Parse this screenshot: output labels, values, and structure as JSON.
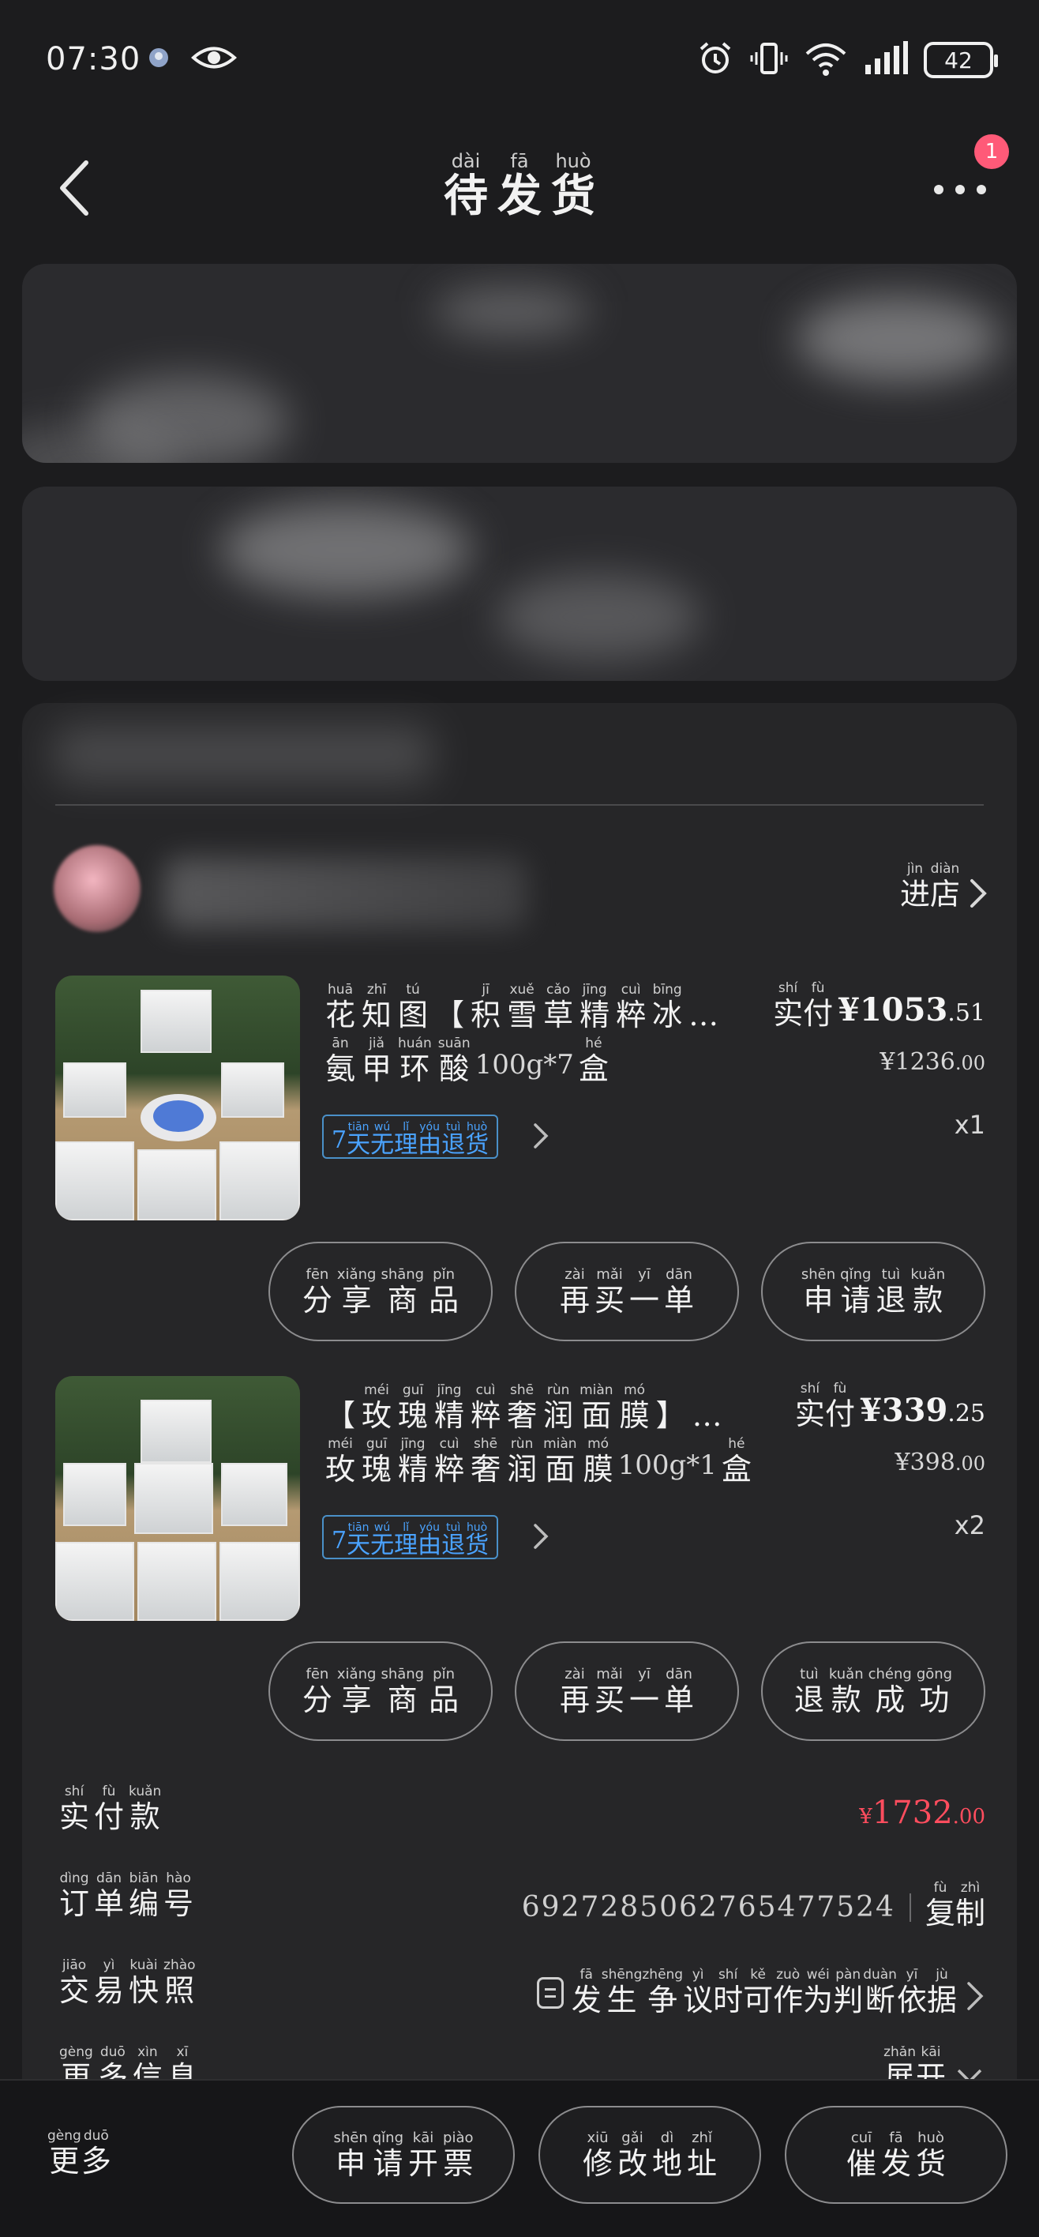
{
  "status_bar": {
    "time": "07:30",
    "battery": "42",
    "icons": [
      "app-notification-icon",
      "eye-icon",
      "alarm-icon",
      "vibrate-icon",
      "wifi-icon",
      "signal-icon",
      "battery-icon"
    ]
  },
  "header": {
    "title": [
      {
        "py": "dài",
        "hz": "待"
      },
      {
        "py": "fā",
        "hz": "发"
      },
      {
        "py": "huò",
        "hz": "货"
      }
    ],
    "badge_count": "1"
  },
  "shop": {
    "enter_store": [
      {
        "py": "jìn",
        "hz": "进"
      },
      {
        "py": "diàn",
        "hz": "店"
      }
    ]
  },
  "products": [
    {
      "title": [
        {
          "py": "huā",
          "hz": "花"
        },
        {
          "py": "zhī",
          "hz": "知"
        },
        {
          "py": "tú",
          "hz": "图"
        },
        {
          "py": "",
          "hz": "【"
        },
        {
          "py": "jī",
          "hz": "积"
        },
        {
          "py": "xuě",
          "hz": "雪"
        },
        {
          "py": "cǎo",
          "hz": "草"
        },
        {
          "py": "jīng",
          "hz": "精"
        },
        {
          "py": "cuì",
          "hz": "粹"
        },
        {
          "py": "bīng",
          "hz": "冰"
        },
        {
          "py": "",
          "hz": "…"
        }
      ],
      "spec_a": [
        {
          "py": "ān",
          "hz": "氨"
        },
        {
          "py": "jiǎ",
          "hz": "甲"
        },
        {
          "py": "huán",
          "hz": "环"
        },
        {
          "py": "suān",
          "hz": "酸"
        }
      ],
      "spec_num": "100g*7",
      "spec_b": [
        {
          "py": "hé",
          "hz": "盒"
        }
      ],
      "paid_label": [
        {
          "py": "shí",
          "hz": "实"
        },
        {
          "py": "fù",
          "hz": "付"
        }
      ],
      "price_int": "¥1053",
      "price_dec": ".51",
      "orig_int": "¥1236",
      "orig_dec": ".00",
      "qty": "x1",
      "buttons": [
        [
          {
            "py": "fēn",
            "hz": "分"
          },
          {
            "py": "xiǎng",
            "hz": "享"
          },
          {
            "py": "shāng",
            "hz": "商"
          },
          {
            "py": "pǐn",
            "hz": "品"
          }
        ],
        [
          {
            "py": "zài",
            "hz": "再"
          },
          {
            "py": "mǎi",
            "hz": "买"
          },
          {
            "py": "yī",
            "hz": "一"
          },
          {
            "py": "dān",
            "hz": "单"
          }
        ],
        [
          {
            "py": "shēn",
            "hz": "申"
          },
          {
            "py": "qǐng",
            "hz": "请"
          },
          {
            "py": "tuì",
            "hz": "退"
          },
          {
            "py": "kuǎn",
            "hz": "款"
          }
        ]
      ]
    },
    {
      "title": [
        {
          "py": "",
          "hz": "【"
        },
        {
          "py": "méi",
          "hz": "玫"
        },
        {
          "py": "guī",
          "hz": "瑰"
        },
        {
          "py": "jīng",
          "hz": "精"
        },
        {
          "py": "cuì",
          "hz": "粹"
        },
        {
          "py": "shē",
          "hz": "奢"
        },
        {
          "py": "rùn",
          "hz": "润"
        },
        {
          "py": "miàn",
          "hz": "面"
        },
        {
          "py": "mó",
          "hz": "膜"
        },
        {
          "py": "",
          "hz": "】"
        },
        {
          "py": "",
          "hz": "…"
        }
      ],
      "spec_a": [
        {
          "py": "méi",
          "hz": "玫"
        },
        {
          "py": "guī",
          "hz": "瑰"
        },
        {
          "py": "jīng",
          "hz": "精"
        },
        {
          "py": "cuì",
          "hz": "粹"
        },
        {
          "py": "shē",
          "hz": "奢"
        },
        {
          "py": "rùn",
          "hz": "润"
        },
        {
          "py": "miàn",
          "hz": "面"
        },
        {
          "py": "mó",
          "hz": "膜"
        }
      ],
      "spec_num": "100g*1",
      "spec_b": [
        {
          "py": "hé",
          "hz": "盒"
        }
      ],
      "paid_label": [
        {
          "py": "shí",
          "hz": "实"
        },
        {
          "py": "fù",
          "hz": "付"
        }
      ],
      "price_int": "¥339",
      "price_dec": ".25",
      "orig_int": "¥398",
      "orig_dec": ".00",
      "qty": "x2",
      "buttons": [
        [
          {
            "py": "fēn",
            "hz": "分"
          },
          {
            "py": "xiǎng",
            "hz": "享"
          },
          {
            "py": "shāng",
            "hz": "商"
          },
          {
            "py": "pǐn",
            "hz": "品"
          }
        ],
        [
          {
            "py": "zài",
            "hz": "再"
          },
          {
            "py": "mǎi",
            "hz": "买"
          },
          {
            "py": "yī",
            "hz": "一"
          },
          {
            "py": "dān",
            "hz": "单"
          }
        ],
        [
          {
            "py": "tuì",
            "hz": "退"
          },
          {
            "py": "kuǎn",
            "hz": "款"
          },
          {
            "py": "chéng",
            "hz": "成"
          },
          {
            "py": "gōng",
            "hz": "功"
          }
        ]
      ]
    }
  ],
  "return_badge": {
    "num": "7",
    "text": [
      {
        "py": "tiān",
        "hz": "天"
      },
      {
        "py": "wú",
        "hz": "无"
      },
      {
        "py": "lǐ",
        "hz": "理"
      },
      {
        "py": "yóu",
        "hz": "由"
      },
      {
        "py": "tuì",
        "hz": "退"
      },
      {
        "py": "huò",
        "hz": "货"
      }
    ]
  },
  "summary": {
    "total_label": [
      {
        "py": "shí",
        "hz": "实"
      },
      {
        "py": "fù",
        "hz": "付"
      },
      {
        "py": "kuǎn",
        "hz": "款"
      }
    ],
    "total_sym": "¥",
    "total_int": "1732",
    "total_dec": ".00",
    "order_label": [
      {
        "py": "dìng",
        "hz": "订"
      },
      {
        "py": "dān",
        "hz": "单"
      },
      {
        "py": "biān",
        "hz": "编"
      },
      {
        "py": "hào",
        "hz": "号"
      }
    ],
    "order_no": "6927285062765477524",
    "copy": [
      {
        "py": "fù",
        "hz": "复"
      },
      {
        "py": "zhì",
        "hz": "制"
      }
    ],
    "snapshot_label": [
      {
        "py": "jiāo",
        "hz": "交"
      },
      {
        "py": "yì",
        "hz": "易"
      },
      {
        "py": "kuài",
        "hz": "快"
      },
      {
        "py": "zhào",
        "hz": "照"
      }
    ],
    "snapshot_text": [
      {
        "py": "fā",
        "hz": "发"
      },
      {
        "py": "shēng",
        "hz": "生"
      },
      {
        "py": "zhēng",
        "hz": "争"
      },
      {
        "py": "yì",
        "hz": "议"
      },
      {
        "py": "shí",
        "hz": "时"
      },
      {
        "py": "kě",
        "hz": "可"
      },
      {
        "py": "zuò",
        "hz": "作"
      },
      {
        "py": "wéi",
        "hz": "为"
      },
      {
        "py": "pàn",
        "hz": "判"
      },
      {
        "py": "duàn",
        "hz": "断"
      },
      {
        "py": "yī",
        "hz": "依"
      },
      {
        "py": "jù",
        "hz": "据"
      }
    ],
    "more_info_label": [
      {
        "py": "gèng",
        "hz": "更"
      },
      {
        "py": "duō",
        "hz": "多"
      },
      {
        "py": "xìn",
        "hz": "信"
      },
      {
        "py": "xī",
        "hz": "息"
      }
    ],
    "expand": [
      {
        "py": "zhǎn",
        "hz": "展"
      },
      {
        "py": "kāi",
        "hz": "开"
      }
    ]
  },
  "bottom_bar": {
    "more": [
      {
        "py": "gèng",
        "hz": "更"
      },
      {
        "py": "duō",
        "hz": "多"
      }
    ],
    "buttons": [
      [
        {
          "py": "shēn",
          "hz": "申"
        },
        {
          "py": "qǐng",
          "hz": "请"
        },
        {
          "py": "kāi",
          "hz": "开"
        },
        {
          "py": "piào",
          "hz": "票"
        }
      ],
      [
        {
          "py": "xiū",
          "hz": "修"
        },
        {
          "py": "gǎi",
          "hz": "改"
        },
        {
          "py": "dì",
          "hz": "地"
        },
        {
          "py": "zhǐ",
          "hz": "址"
        }
      ],
      [
        {
          "py": "cuī",
          "hz": "催"
        },
        {
          "py": "fā",
          "hz": "发"
        },
        {
          "py": "huò",
          "hz": "货"
        }
      ]
    ]
  },
  "colors": {
    "price_red": "#ff4d5e",
    "badge_pink": "#ff5a78",
    "return_blue": "#4aa3ff"
  }
}
